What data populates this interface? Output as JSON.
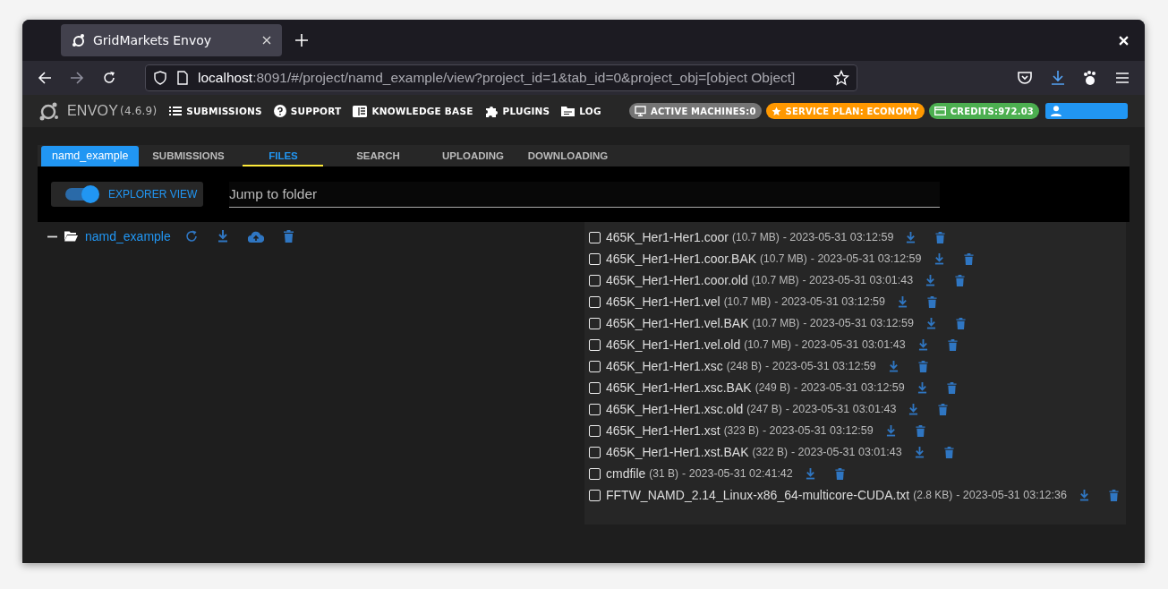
{
  "browser": {
    "tab_title": "GridMarkets Envoy",
    "url_host": "localhost",
    "url_rest": ":8091/#/project/namd_example/view?project_id=1&tab_id=0&project_obj=[object Object]"
  },
  "navbar": {
    "brand": "ENVOY",
    "version": "(4.6.9)",
    "links": [
      {
        "kind": "list",
        "label": "SUBMISSIONS"
      },
      {
        "kind": "help",
        "label": "SUPPORT"
      },
      {
        "kind": "book",
        "label": "KNOWLEDGE BASE"
      },
      {
        "kind": "puzzle",
        "label": "PLUGINS"
      },
      {
        "kind": "folder",
        "label": "LOG"
      }
    ],
    "badges": [
      {
        "kind": "monitor",
        "label": "ACTIVE MACHINES:0",
        "color": "#757575"
      },
      {
        "kind": "star",
        "label": "SERVICE PLAN: ECONOMY",
        "color": "#ff9800"
      },
      {
        "kind": "card",
        "label": "CREDITS:972.03",
        "color": "#4caf50"
      },
      {
        "kind": "user",
        "color": "#2196f3"
      }
    ]
  },
  "project": "namd_example",
  "tabs": [
    {
      "label": "SUBMISSIONS",
      "selected": false
    },
    {
      "label": "FILES",
      "selected": true
    },
    {
      "label": "SEARCH",
      "selected": false
    },
    {
      "label": "UPLOADING",
      "selected": false
    },
    {
      "label": "DOWNLOADING",
      "selected": false
    }
  ],
  "explorer_view": {
    "label": "EXPLORER VIEW",
    "on": true
  },
  "jump": {
    "placeholder": "Jump to folder"
  },
  "tree": {
    "folder": "namd_example",
    "expanded": true
  },
  "files": [
    {
      "name": "465K_Her1-Her1.coor",
      "size": "(10.7 MB)",
      "date": "- 2023-05-31 03:12:59",
      "checked": false
    },
    {
      "name": "465K_Her1-Her1.coor.BAK",
      "size": "(10.7 MB)",
      "date": "- 2023-05-31 03:12:59",
      "checked": false
    },
    {
      "name": "465K_Her1-Her1.coor.old",
      "size": "(10.7 MB)",
      "date": "- 2023-05-31 03:01:43",
      "checked": false
    },
    {
      "name": "465K_Her1-Her1.vel",
      "size": "(10.7 MB)",
      "date": "- 2023-05-31 03:12:59",
      "checked": false
    },
    {
      "name": "465K_Her1-Her1.vel.BAK",
      "size": "(10.7 MB)",
      "date": "- 2023-05-31 03:12:59",
      "checked": false
    },
    {
      "name": "465K_Her1-Her1.vel.old",
      "size": "(10.7 MB)",
      "date": "- 2023-05-31 03:01:43",
      "checked": false
    },
    {
      "name": "465K_Her1-Her1.xsc",
      "size": "(248 B)",
      "date": "- 2023-05-31 03:12:59",
      "checked": false
    },
    {
      "name": "465K_Her1-Her1.xsc.BAK",
      "size": "(249 B)",
      "date": "- 2023-05-31 03:12:59",
      "checked": false
    },
    {
      "name": "465K_Her1-Her1.xsc.old",
      "size": "(247 B)",
      "date": "- 2023-05-31 03:01:43",
      "checked": false
    },
    {
      "name": "465K_Her1-Her1.xst",
      "size": "(323 B)",
      "date": "- 2023-05-31 03:12:59",
      "checked": false
    },
    {
      "name": "465K_Her1-Her1.xst.BAK",
      "size": "(322 B)",
      "date": "- 2023-05-31 03:01:43",
      "checked": false
    },
    {
      "name": "cmdfile",
      "size": "(31 B)",
      "date": "- 2023-05-31 02:41:42",
      "checked": false
    },
    {
      "name": "FFTW_NAMD_2.14_Linux-x86_64-multicore-CUDA.txt",
      "size": "(2.8 KB)",
      "date": "- 2023-05-31 03:12:36",
      "checked": false
    }
  ]
}
